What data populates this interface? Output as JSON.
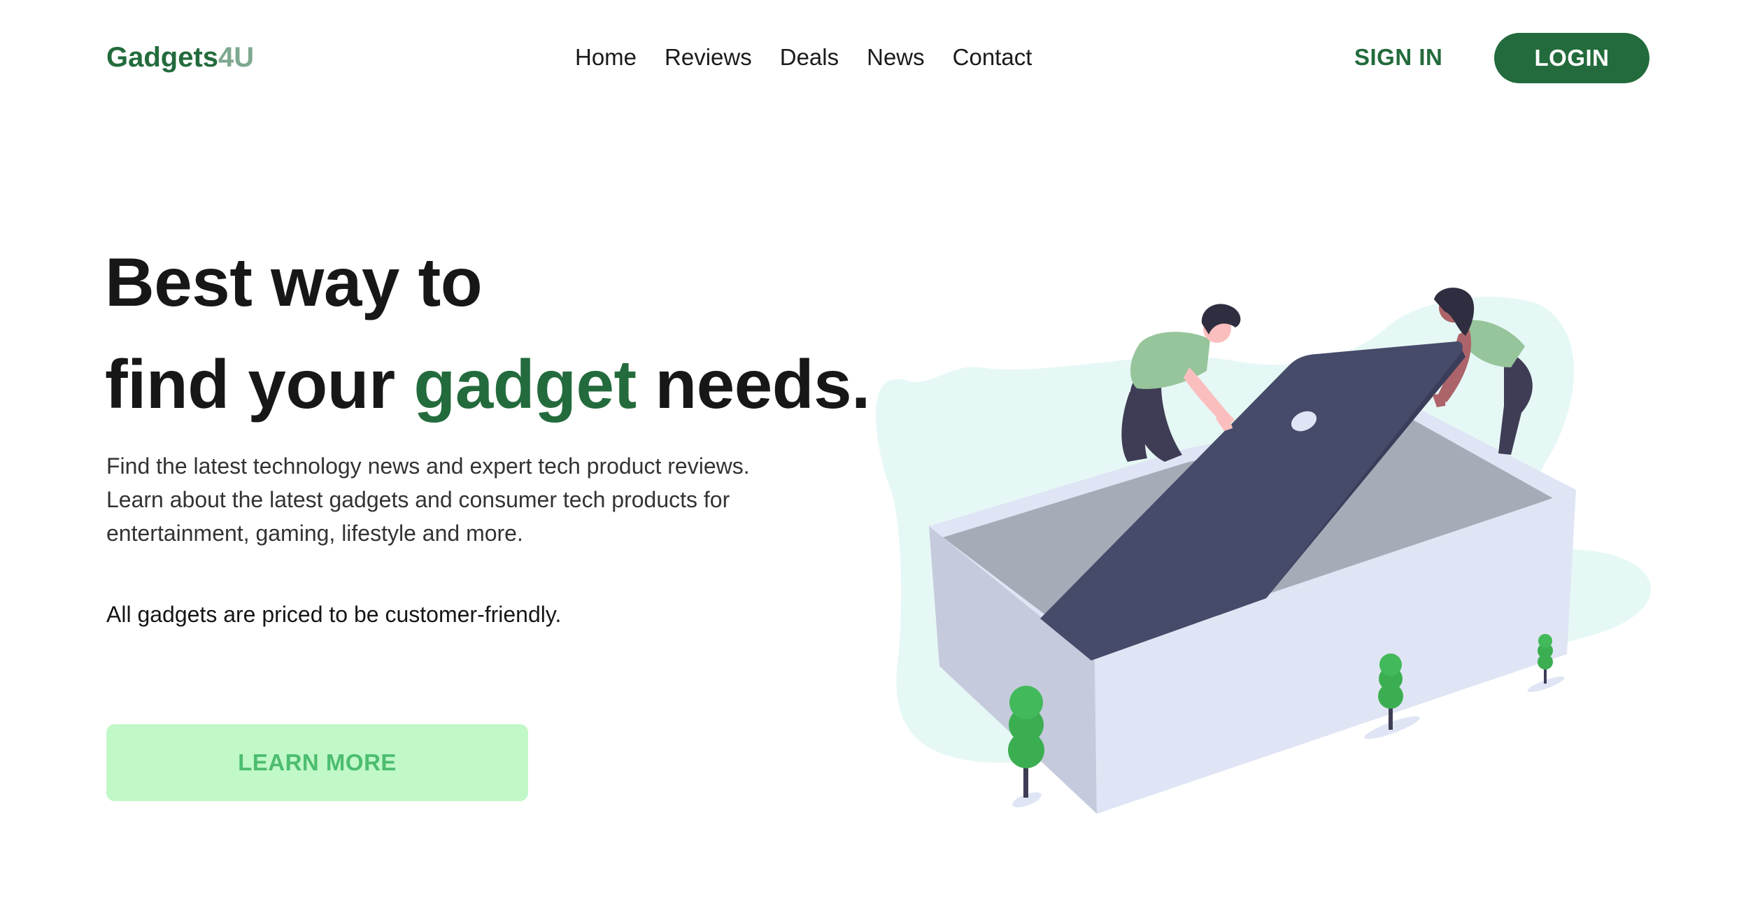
{
  "header": {
    "logo_main": "Gadgets",
    "logo_suffix": "4U",
    "nav": [
      "Home",
      "Reviews",
      "Deals",
      "News",
      "Contact"
    ],
    "sign_in_label": "SIGN IN",
    "login_label": "LOGIN"
  },
  "hero": {
    "headline_line1": "Best way to",
    "headline_line2_start": "find your ",
    "headline_accent": "gadget",
    "headline_line2_end": " needs.",
    "description": "Find the latest technology news and expert tech product reviews. Learn about the latest gadgets and consumer tech products for entertainment, gaming, lifestyle and more.",
    "note": "All gadgets are priced to be customer-friendly.",
    "cta_label": "LEARN MORE"
  },
  "colors": {
    "brand": "#236b3c",
    "brand_light": "#7ea88f",
    "cta_bg": "#c1f8c8",
    "cta_text": "#4cbd6f",
    "blob": "#e6f8f5",
    "phone": "#474b6a",
    "box_light": "#dfe5f4",
    "box_side": "#c5cbdc",
    "box_inside": "#a6abb8",
    "tree": "#3cae52"
  },
  "illustration_icon": "people-placing-phone-in-box-illustration"
}
